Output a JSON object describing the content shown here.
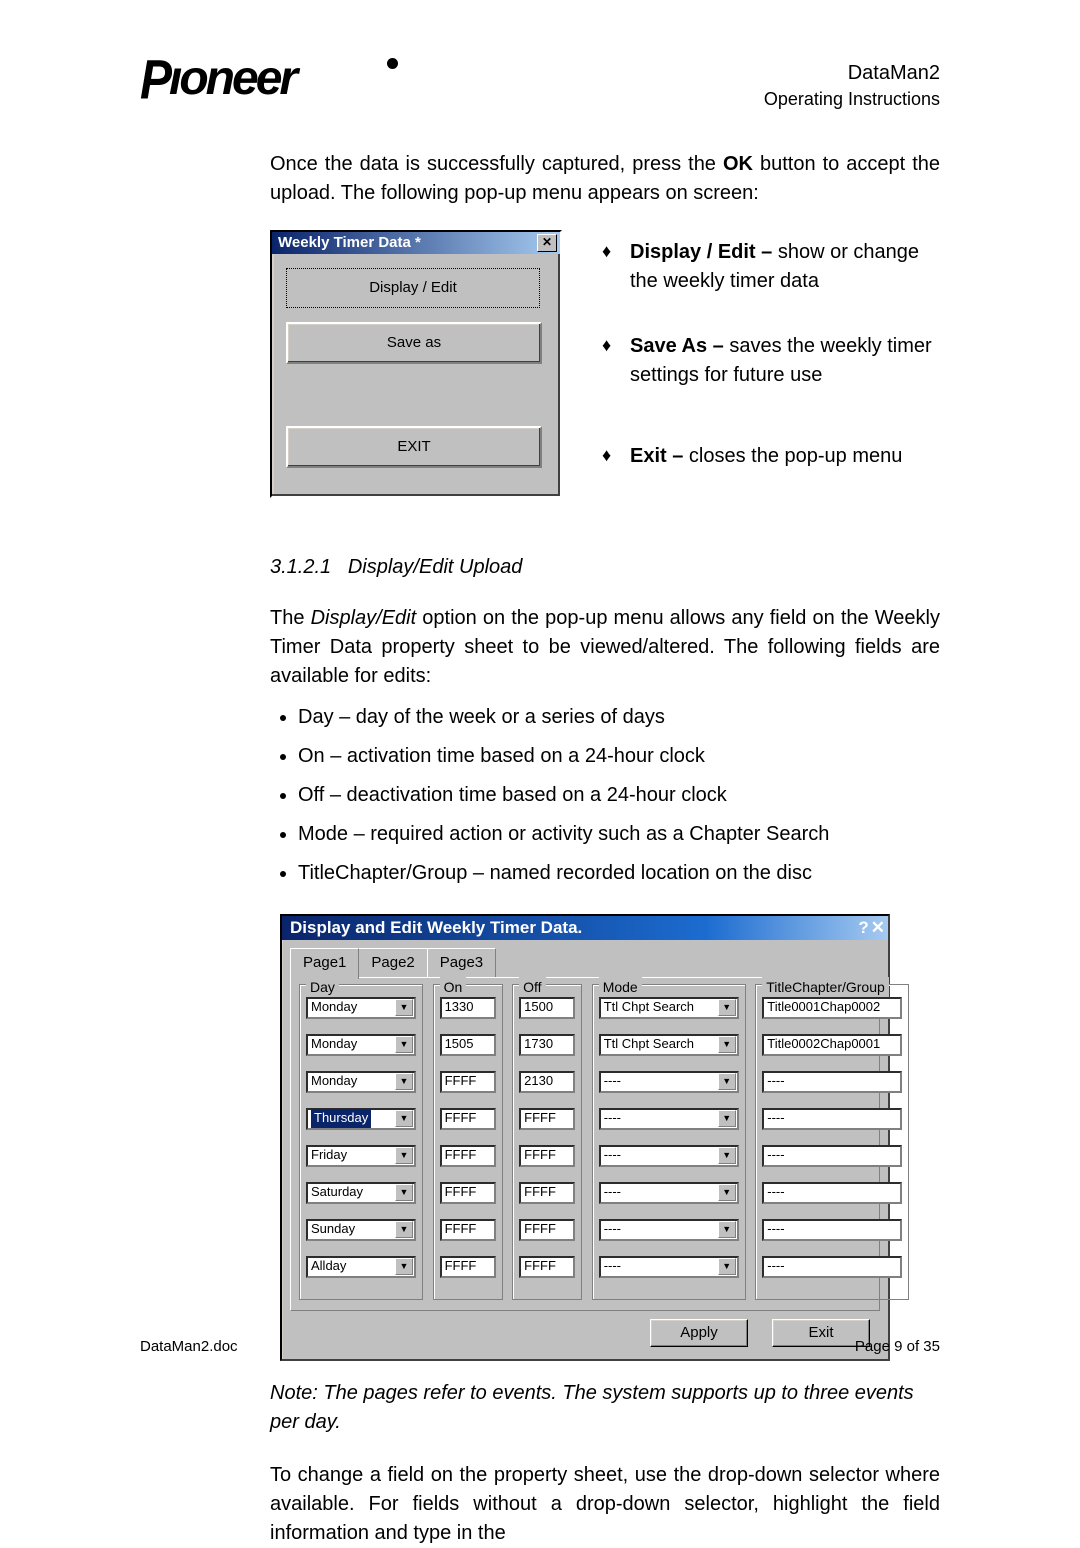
{
  "header": {
    "title": "DataMan2",
    "subtitle": "Operating Instructions",
    "logo_alt": "Pioneer"
  },
  "intro": "Once the data is successfully captured, press the <b>OK</b> button to accept the upload. The following pop-up menu appears on screen:",
  "popup": {
    "title": "Weekly Timer Data *",
    "buttons": [
      "Display / Edit",
      "Save as",
      "EXIT"
    ]
  },
  "side_bullets": [
    {
      "b": "Display / Edit –",
      "t": " show or change the weekly timer data"
    },
    {
      "b": "Save As –",
      "t": " saves the weekly timer settings for future use"
    },
    {
      "b": "Exit –",
      "t": " closes the pop-up menu"
    }
  ],
  "section_no": "3.1.2.1",
  "section_title": "Display/Edit Upload",
  "section_para": "The <i>Display/Edit</i> option on the pop-up menu allows any field on the Weekly Timer Data property sheet to be viewed/altered. The following fields are available for edits:",
  "field_list": [
    "Day – day of the week or a series of days",
    "On – activation time based on a 24-hour clock",
    "Off – deactivation time based on a 24-hour clock",
    "Mode – required action or activity such as a Chapter Search",
    "TitleChapter/Group – named recorded location on the disc"
  ],
  "dialog2": {
    "title": "Display and Edit Weekly Timer Data.",
    "tabs": [
      "Page1",
      "Page2",
      "Page3"
    ],
    "legends": {
      "day": "Day",
      "on": "On",
      "off": "Off",
      "mode": "Mode",
      "tcg": "TitleChapter/Group"
    },
    "rows": [
      {
        "day": "Monday",
        "on": "1330",
        "off": "1500",
        "mode": "Ttl Chpt Search",
        "tcg": "Title0001Chap0002"
      },
      {
        "day": "Monday",
        "on": "1505",
        "off": "1730",
        "mode": "Ttl Chpt Search",
        "tcg": "Title0002Chap0001"
      },
      {
        "day": "Monday",
        "on": "FFFF",
        "off": "2130",
        "mode": "----",
        "tcg": "----"
      },
      {
        "day": "Thursday",
        "on": "FFFF",
        "off": "FFFF",
        "mode": "----",
        "tcg": "----",
        "sel": true
      },
      {
        "day": "Friday",
        "on": "FFFF",
        "off": "FFFF",
        "mode": "----",
        "tcg": "----"
      },
      {
        "day": "Saturday",
        "on": "FFFF",
        "off": "FFFF",
        "mode": "----",
        "tcg": "----"
      },
      {
        "day": "Sunday",
        "on": "FFFF",
        "off": "FFFF",
        "mode": "----",
        "tcg": "----"
      },
      {
        "day": "Allday",
        "on": "FFFF",
        "off": "FFFF",
        "mode": "----",
        "tcg": "----"
      }
    ],
    "apply": "Apply",
    "exit": "Exit"
  },
  "note": "Note: The pages refer to events.  The system supports up to three events per day.",
  "para2": "To change a field on the property sheet, use the drop-down selector where available. For fields without a drop-down selector, highlight the field information and type in the",
  "footer": {
    "left": "DataMan2.doc",
    "right": "Page 9 of 35"
  }
}
